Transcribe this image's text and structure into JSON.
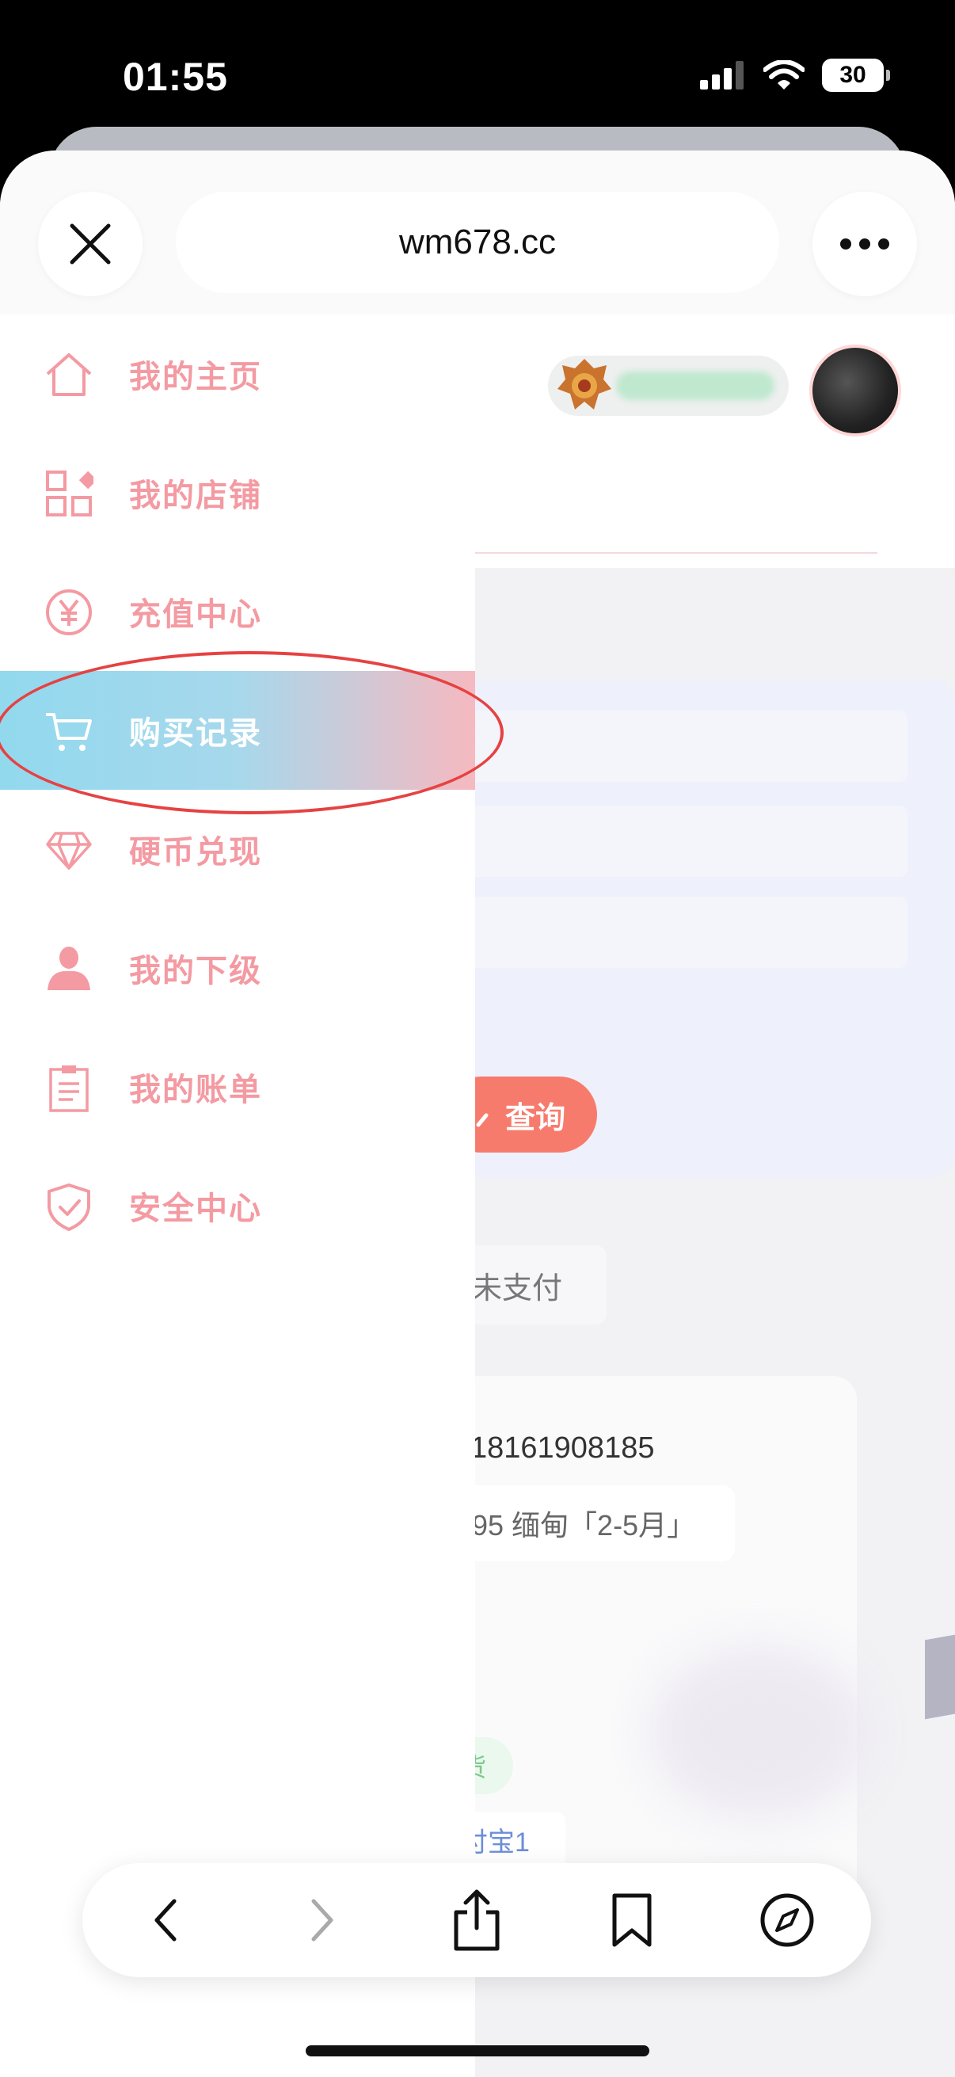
{
  "status_bar": {
    "time": "01:55",
    "battery": "30"
  },
  "browser": {
    "url": "wm678.cc"
  },
  "page": {
    "query_label": "查询",
    "tab_unpaid": "未支付",
    "order_number": "18161908185",
    "order_tag": "95 缅甸「2-5月」",
    "status_chip": "货",
    "link_chip": "付宝1"
  },
  "drawer": {
    "items": [
      {
        "label": "我的主页",
        "icon": "home-icon"
      },
      {
        "label": "我的店铺",
        "icon": "store-grid-icon"
      },
      {
        "label": "充值中心",
        "icon": "yen-icon"
      },
      {
        "label": "购买记录",
        "icon": "cart-icon",
        "active": true
      },
      {
        "label": "硬币兑现",
        "icon": "diamond-icon"
      },
      {
        "label": "我的下级",
        "icon": "person-icon"
      },
      {
        "label": "我的账单",
        "icon": "clipboard-icon"
      },
      {
        "label": "安全中心",
        "icon": "shield-check-icon"
      }
    ]
  },
  "colors": {
    "menu_text": "#f49aa2",
    "active_gradient_start": "#92d9ee",
    "active_gradient_end": "#f6b9c0",
    "query_button": "#f77b6c",
    "annotation": "#e64242"
  }
}
